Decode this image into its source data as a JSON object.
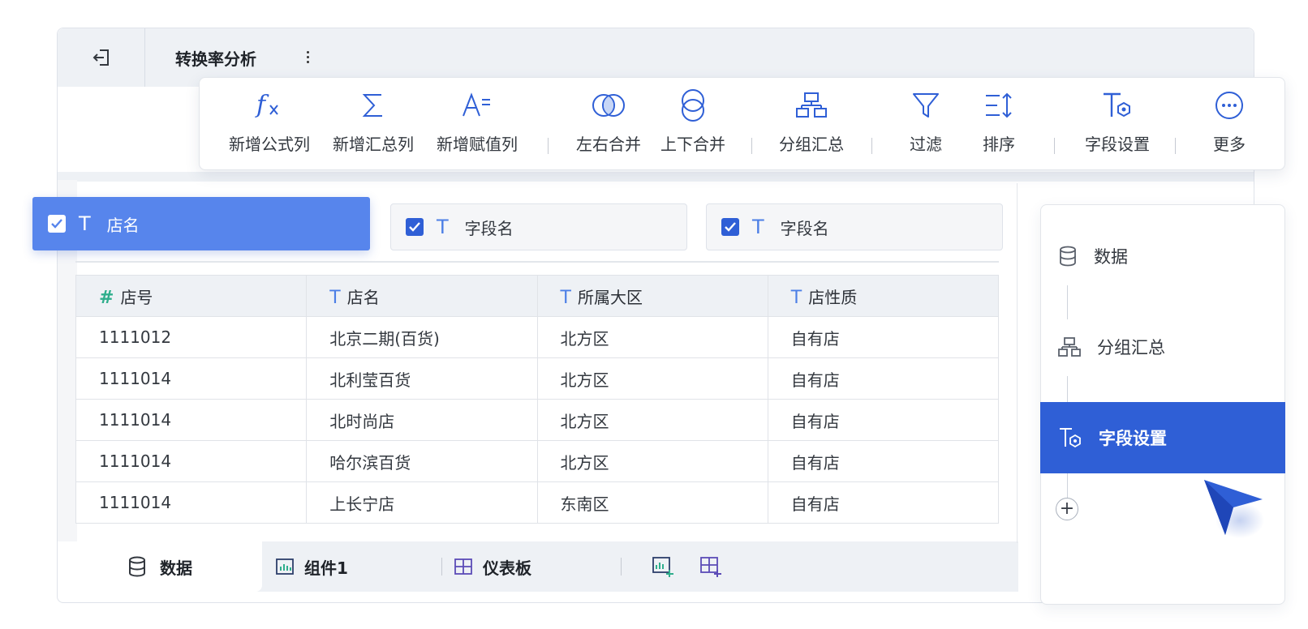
{
  "header": {
    "back_icon": "exit-icon",
    "title": "转换率分析",
    "more_icon": "vertical-dots-icon"
  },
  "toolbar": {
    "items": [
      {
        "label": "新增公式列",
        "icon": "formula-fx-icon"
      },
      {
        "label": "新增汇总列",
        "icon": "sigma-icon"
      },
      {
        "label": "新增赋值列",
        "icon": "assign-value-icon"
      },
      {
        "label": "左右合并",
        "icon": "merge-horizontal-icon"
      },
      {
        "label": "上下合并",
        "icon": "merge-vertical-icon"
      },
      {
        "label": "分组汇总",
        "icon": "group-summary-icon"
      },
      {
        "label": "过滤",
        "icon": "filter-icon"
      },
      {
        "label": "排序",
        "icon": "sort-icon"
      },
      {
        "label": "字段设置",
        "icon": "field-settings-icon"
      },
      {
        "label": "更多",
        "icon": "more-icon"
      }
    ]
  },
  "fields": [
    {
      "name": "店名",
      "checked": true,
      "type_glyph": "T",
      "active": true
    },
    {
      "name": "字段名",
      "checked": true,
      "type_glyph": "T",
      "active": false
    },
    {
      "name": "字段名",
      "checked": true,
      "type_glyph": "T",
      "active": false
    }
  ],
  "table": {
    "columns": [
      {
        "label": "店号",
        "type_glyph": "#"
      },
      {
        "label": "店名",
        "type_glyph": "T"
      },
      {
        "label": "所属大区",
        "type_glyph": "T"
      },
      {
        "label": "店性质",
        "type_glyph": "T"
      }
    ],
    "rows": [
      [
        "1111012",
        "北京二期(百货)",
        "北方区",
        "自有店"
      ],
      [
        "1111014",
        "北利莹百货",
        "北方区",
        "自有店"
      ],
      [
        "1111014",
        "北时尚店",
        "北方区",
        "自有店"
      ],
      [
        "1111014",
        "哈尔滨百货",
        "北方区",
        "自有店"
      ],
      [
        "1111014",
        "上长宁店",
        "东南区",
        "自有店"
      ]
    ]
  },
  "bottom_tabs": {
    "data_tab": "数据",
    "component_tab": "组件1",
    "dashboard_tab": "仪表板",
    "add_component_icon": "add-component-icon",
    "add_dashboard_icon": "add-dashboard-icon"
  },
  "steps": {
    "items": [
      {
        "label": "数据",
        "icon": "database-icon",
        "active": false
      },
      {
        "label": "分组汇总",
        "icon": "group-summary-icon",
        "active": false
      },
      {
        "label": "字段设置",
        "icon": "field-settings-icon",
        "active": true
      }
    ],
    "add_label": "+"
  },
  "colors": {
    "accent": "#2f5fd6",
    "accent_light": "#5785ec",
    "header_bg": "#eef1f5",
    "hash_green": "#2fae8c"
  }
}
